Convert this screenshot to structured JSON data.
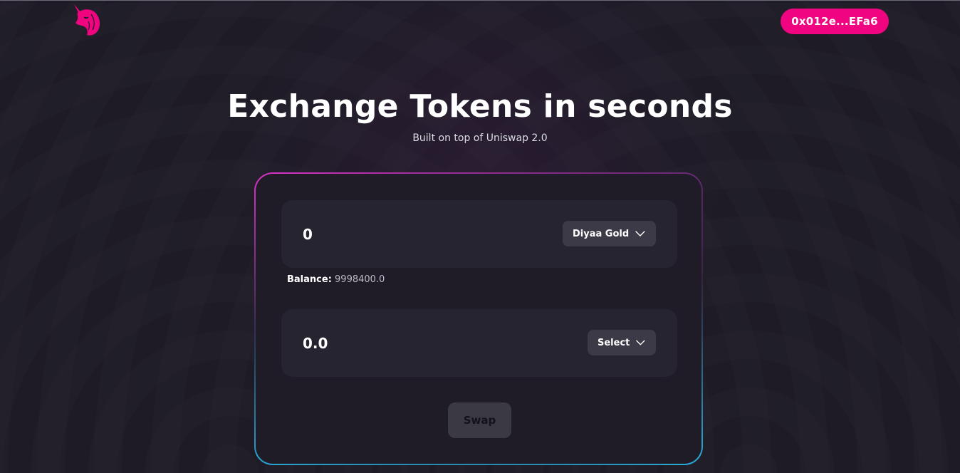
{
  "header": {
    "logo_icon": "unicorn-logo-icon",
    "wallet_address": "0x012e...EFa6"
  },
  "hero": {
    "title": "Exchange Tokens in seconds",
    "subtitle": "Built on top of Uniswap 2.0"
  },
  "swap": {
    "from": {
      "amount": "0",
      "token_label": "Diyaa Gold",
      "balance_label": "Balance:",
      "balance_value": "9998400.0"
    },
    "to": {
      "amount": "0.0",
      "token_label": "Select"
    },
    "swap_label": "Swap"
  },
  "colors": {
    "accent": "#f0047f",
    "background": "#1e1b26",
    "field_background": "#262430",
    "button_background": "#3b3a46",
    "card_border_start": "#e235d4",
    "card_border_end": "#2bb4e4"
  }
}
